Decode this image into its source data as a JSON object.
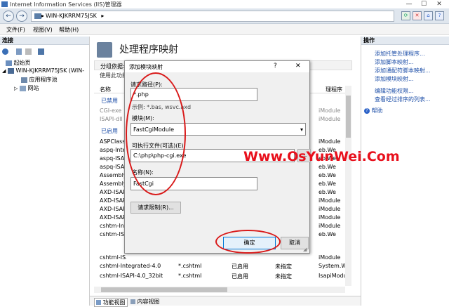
{
  "window": {
    "title": "Internet Information Services (IIS)管理器",
    "min": "—",
    "max": "☐",
    "close": "✕"
  },
  "address": {
    "back": "←",
    "forward": "→",
    "path": "WIN-KJKRRM75JSK",
    "arrow": "▸",
    "dropdown": "▾"
  },
  "menu": [
    "文件(F)",
    "视图(V)",
    "帮助(H)"
  ],
  "connections": {
    "header": "连接",
    "start_page": "起始页",
    "server": "WIN-KJKRRM75JSK (WIN-",
    "app_pools": "应用程序池",
    "sites": "网站"
  },
  "center": {
    "title": "处理程序映射",
    "group_by": "分组依据:",
    "info_prefix": "使用此功能",
    "col_name": "名称",
    "col_handler_partial": "理程序",
    "enabled_group": "已禁用",
    "enabled_group2": "已启用",
    "rows_left": [
      "CGI-exe",
      "ISAPI-dll",
      "",
      "ASPClassic",
      "aspq-Integ",
      "aspq-ISAPI",
      "aspq-ISAPI",
      "Assembly",
      "Assembly",
      "AXD-ISAPI",
      "AXD-ISAPI",
      "AXD-ISAPI",
      "AXD-ISAPI",
      "cshtm-Inte",
      "cshtm-ISAP",
      "cshtml-ISAPI-4.0_64bit"
    ],
    "rows_right": [
      "iModule",
      "iModule",
      "",
      "iModule",
      "eb.We",
      "eb.We",
      "eb.We",
      "eb.We",
      "eb.We",
      "eb.We",
      "iModule",
      "iModule",
      "iModule",
      "iModule",
      "eb.We",
      "iModule"
    ],
    "row_a": {
      "name": "cshtml-Integrated-4.0",
      "path": "*.cshtml",
      "state": "已启用",
      "type": "未指定",
      "handler": "System.We"
    },
    "row_b": {
      "name": "cshtml-ISAPI-4.0_32bit",
      "path": "*.cshtml",
      "state": "已启用",
      "type": "未指定",
      "handler": "IsapiModule"
    },
    "tab_features": "功能视图",
    "tab_content": "内容视图"
  },
  "actions": {
    "header": "操作",
    "items": [
      "添加托管处理程序...",
      "添加脚本映射...",
      "添加通配符脚本映射...",
      "添加模块映射...",
      "编辑功能权限...",
      "查看经过排序的列表..."
    ],
    "help": "帮助"
  },
  "dialog": {
    "title": "添加模块映射",
    "help": "?",
    "close": "✕",
    "path_label": "请求路径(P):",
    "path_value": "*.php",
    "example": "示例: *.bas, wsvc.axd",
    "module_label": "模块(M):",
    "module_value": "FastCgiModule",
    "exe_label": "可执行文件(可选)(E):",
    "exe_value": "C:\\php\\php-cgi.exe",
    "browse": "...",
    "name_label": "名称(N):",
    "name_value": "FastCgi",
    "restrictions": "请求限制(R)...",
    "ok": "确定",
    "cancel": "取消"
  },
  "watermark": "Www.OsYunWei.Com",
  "colors": {
    "accent": "#1e4fa8",
    "highlight": "#d91a1a"
  }
}
